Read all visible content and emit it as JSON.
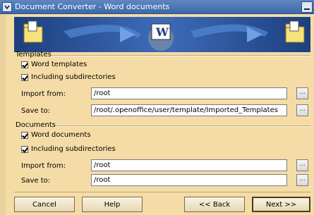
{
  "window": {
    "title": "Document Converter - Word documents"
  },
  "templates": {
    "group_label": "Templates",
    "word_label": "Word templates",
    "word_checked": true,
    "subdirs_label": "Including subdirectories",
    "subdirs_checked": true,
    "import_label": "Import from:",
    "import_value": "/root",
    "save_label": "Save to:",
    "save_value": "/root/.openoffice/user/template/Imported_Templates",
    "browse_label": "..."
  },
  "documents": {
    "group_label": "Documents",
    "word_label": "Word documents",
    "word_checked": true,
    "subdirs_label": "Including subdirectories",
    "subdirs_checked": true,
    "import_label": "Import from:",
    "import_value": "/root",
    "save_label": "Save to:",
    "save_value": "/root",
    "browse_label": "..."
  },
  "buttons": {
    "cancel": "Cancel",
    "help": "Help",
    "back": "<< Back",
    "next": "Next >>"
  },
  "colors": {
    "background": "#f5dca6",
    "titlebar": "#4a74b4",
    "banner": "#2e58a3"
  }
}
